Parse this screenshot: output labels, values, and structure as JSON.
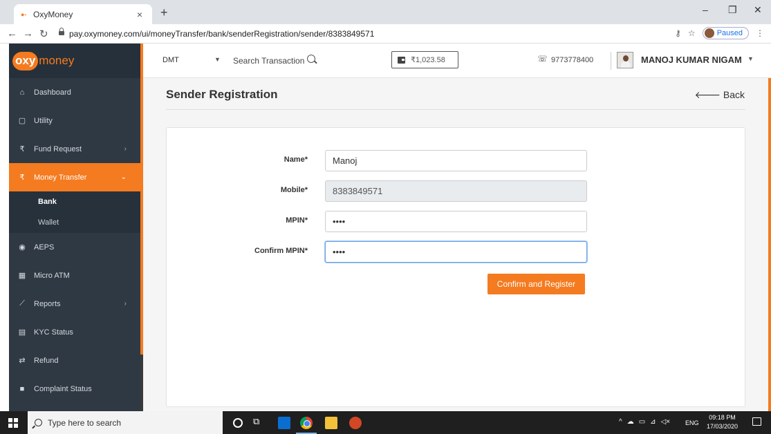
{
  "browser": {
    "tab_title": "OxyMoney",
    "favicon": "oxymoney-favicon",
    "url": "pay.oxymoney.com/ui/moneyTransfer/bank/senderRegistration/sender/8383849571",
    "profile_status": "Paused"
  },
  "sidebar": {
    "logo_oxy": "oxy",
    "logo_money": "money",
    "items": [
      {
        "label": "Dashboard",
        "icon": "home-icon"
      },
      {
        "label": "Utility",
        "icon": "square-icon"
      },
      {
        "label": "Fund Request",
        "icon": "rupee-icon",
        "chevron": "›"
      },
      {
        "label": "Money Transfer",
        "icon": "rupee-icon",
        "chevron": "⌄",
        "active": true
      },
      {
        "label": "AEPS",
        "icon": "fingerprint-icon"
      },
      {
        "label": "Micro ATM",
        "icon": "bank-icon"
      },
      {
        "label": "Reports",
        "icon": "chart-icon",
        "chevron": "›"
      },
      {
        "label": "KYC Status",
        "icon": "id-card-icon"
      },
      {
        "label": "Refund",
        "icon": "exchange-icon"
      },
      {
        "label": "Complaint Status",
        "icon": "comment-icon"
      }
    ],
    "sub_items": [
      {
        "label": "Bank",
        "current": true
      },
      {
        "label": "Wallet"
      }
    ]
  },
  "header": {
    "service": "DMT",
    "search_label": "Search Transaction",
    "balance": "₹1,023.58",
    "phone": "9773778400",
    "username": "MANOJ KUMAR NIGAM"
  },
  "page": {
    "title": "Sender Registration",
    "back_label": "Back"
  },
  "form": {
    "name_label": "Name*",
    "name_value": "Manoj",
    "mobile_label": "Mobile*",
    "mobile_value": "8383849571",
    "mpin_label": "MPIN*",
    "mpin_value": "••••",
    "confirm_mpin_label": "Confirm MPIN*",
    "confirm_mpin_value": "••••",
    "submit_label": "Confirm and Register"
  },
  "taskbar": {
    "search_placeholder": "Type here to search",
    "language": "ENG",
    "time": "09:18 PM",
    "date": "17/03/2020"
  },
  "colors": {
    "accent": "#f47b20",
    "sidebar_bg": "#2f3944",
    "focus_border": "#6aa7e8"
  }
}
